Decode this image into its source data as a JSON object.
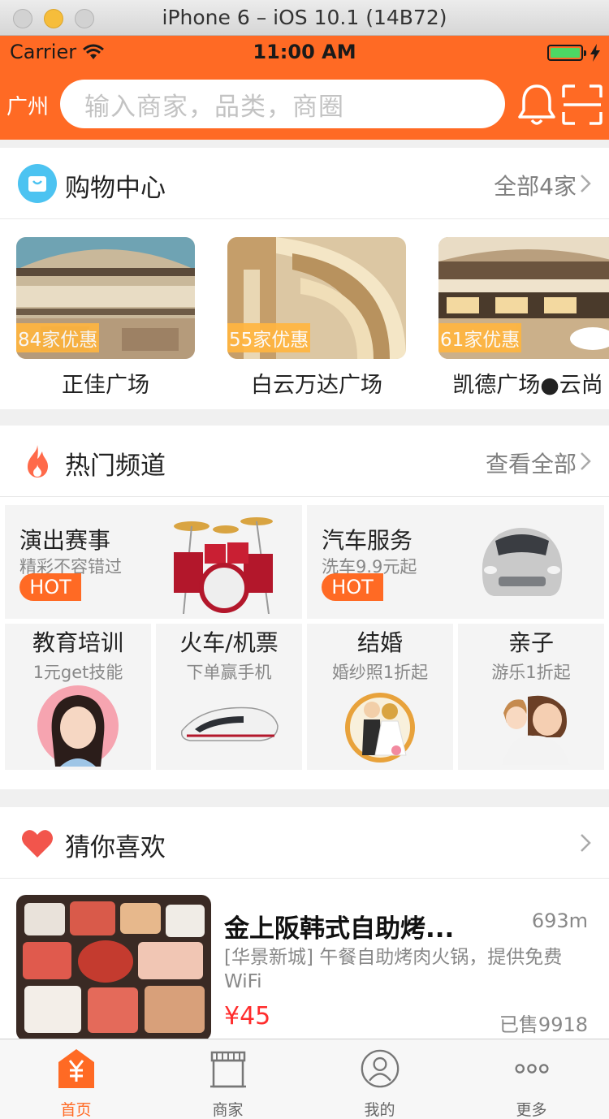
{
  "window": {
    "title": "iPhone 6 – iOS 10.1 (14B72)"
  },
  "status_bar": {
    "carrier": "Carrier",
    "time": "11:00 AM"
  },
  "header": {
    "city": "广州",
    "search_placeholder": "输入商家，品类，商圈"
  },
  "shopping": {
    "title": "购物中心",
    "more": "全部4家",
    "malls": [
      {
        "name": "正佳广场",
        "badge": "84家优惠"
      },
      {
        "name": "白云万达广场",
        "badge": "55家优惠"
      },
      {
        "name": "凯德广场●云尚",
        "badge": "61家优惠"
      }
    ]
  },
  "hot": {
    "title": "热门频道",
    "more": "查看全部",
    "big": [
      {
        "title": "演出赛事",
        "sub": "精彩不容错过",
        "badge": "HOT"
      },
      {
        "title": "汽车服务",
        "sub": "洗车9.9元起",
        "badge": "HOT"
      }
    ],
    "small": [
      {
        "title": "教育培训",
        "sub": "1元get技能"
      },
      {
        "title": "火车/机票",
        "sub": "下单赢手机"
      },
      {
        "title": "结婚",
        "sub": "婚纱照1折起"
      },
      {
        "title": "亲子",
        "sub": "游乐1折起"
      }
    ]
  },
  "guess": {
    "title": "猜你喜欢",
    "deal": {
      "title": "金上阪韩式自助烤...",
      "distance": "693m",
      "desc": "[华景新城] 午餐自助烤肉火锅，提供免费WiFi",
      "price": "¥45",
      "sold": "已售9918"
    }
  },
  "tabbar": [
    {
      "label": "首页",
      "active": true,
      "icon": "home-yen-icon"
    },
    {
      "label": "商家",
      "active": false,
      "icon": "store-icon"
    },
    {
      "label": "我的",
      "active": false,
      "icon": "user-icon"
    },
    {
      "label": "更多",
      "active": false,
      "icon": "more-icon"
    }
  ],
  "colors": {
    "brand": "#ff6a24",
    "price": "#ff2d2d",
    "badge": "#ffb640"
  }
}
